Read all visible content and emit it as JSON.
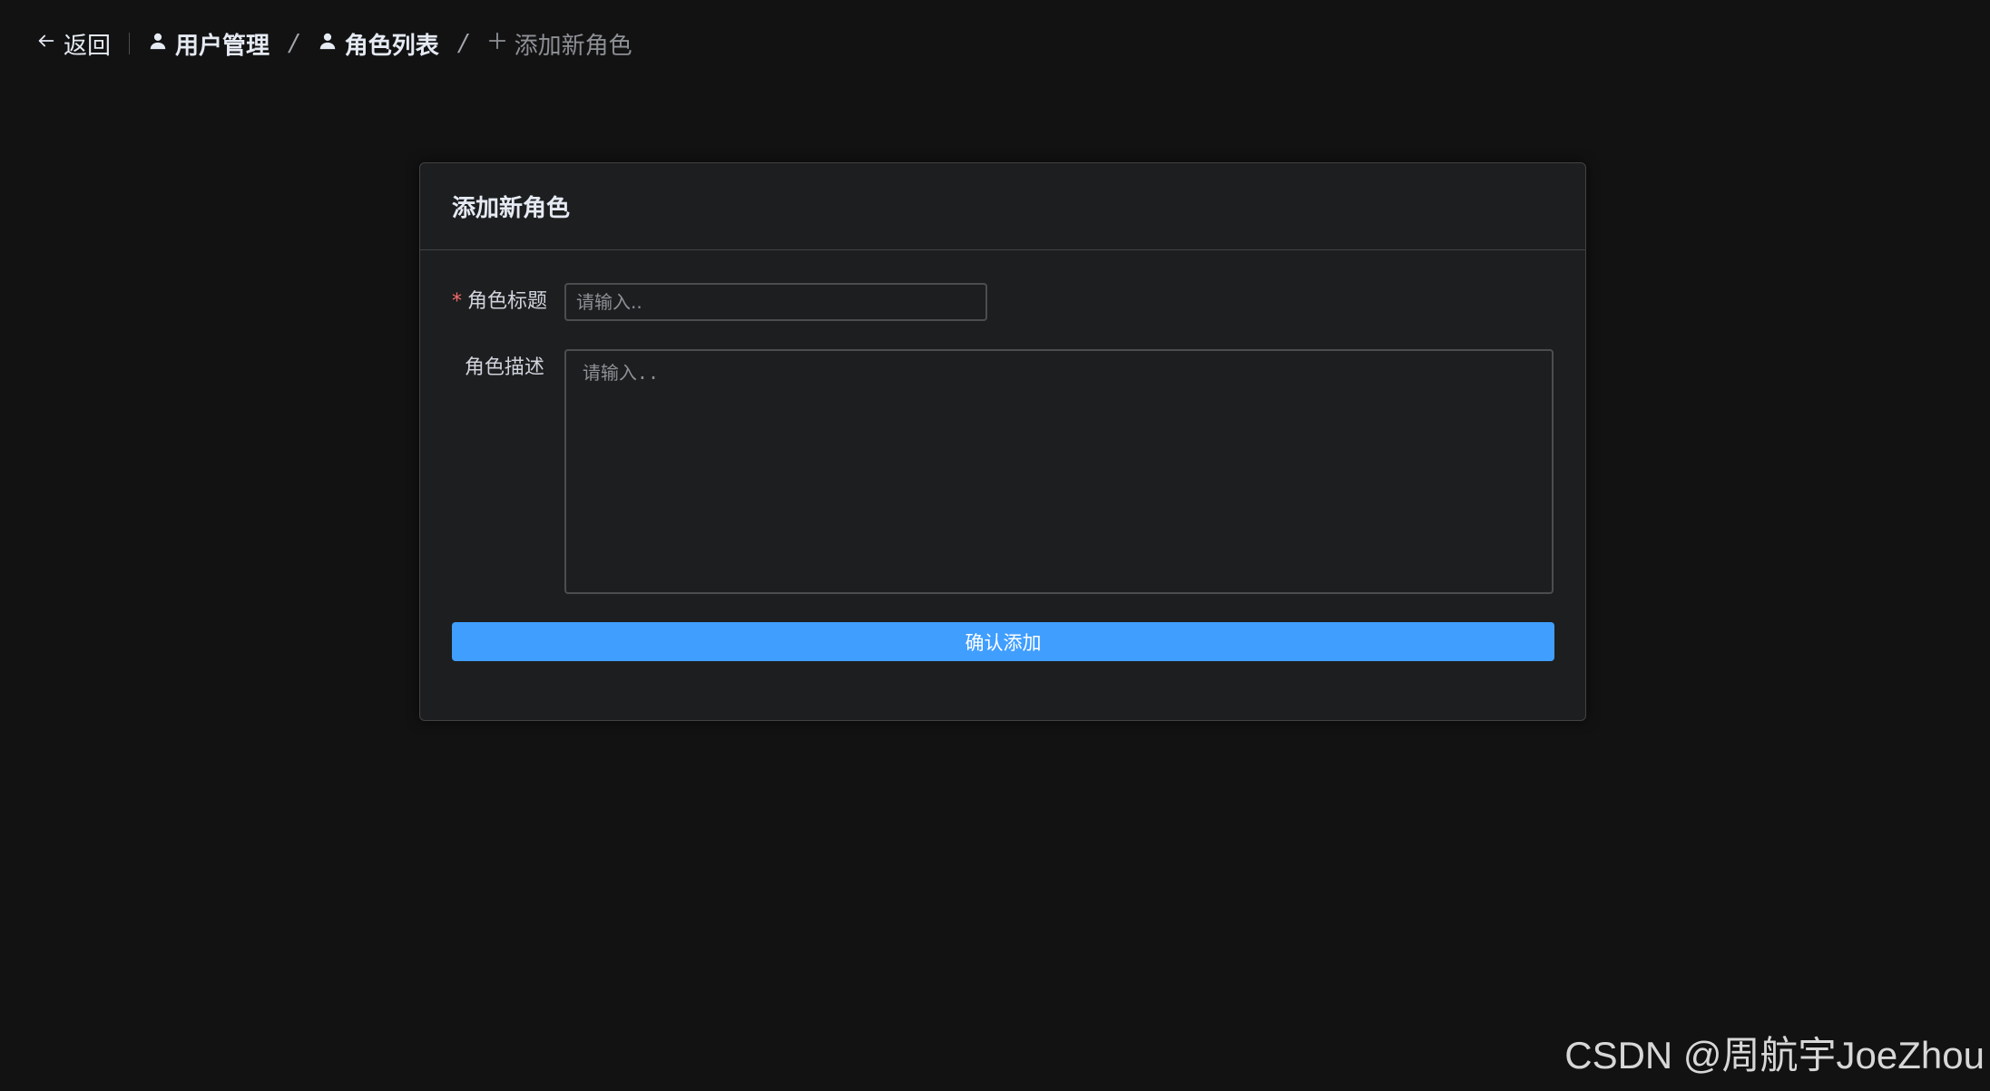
{
  "topbar": {
    "back_label": "返回",
    "breadcrumbs": [
      {
        "label": "用户管理",
        "icon": "user-icon"
      },
      {
        "label": "角色列表",
        "icon": "user-icon"
      },
      {
        "label": "添加新角色",
        "icon": "plus-icon"
      }
    ],
    "separator": "/"
  },
  "card": {
    "title": "添加新角色",
    "form": {
      "title_field": {
        "label": "角色标题",
        "required_mark": "*",
        "value": "",
        "placeholder": "请输入.."
      },
      "description_field": {
        "label": "角色描述",
        "value": "",
        "placeholder": "请输入.."
      },
      "submit_label": "确认添加"
    }
  },
  "watermark": "CSDN @周航宇JoeZhou",
  "colors": {
    "background": "#121212",
    "card": "#1d1e1f",
    "primary": "#409eff",
    "required": "#f56c6c"
  }
}
